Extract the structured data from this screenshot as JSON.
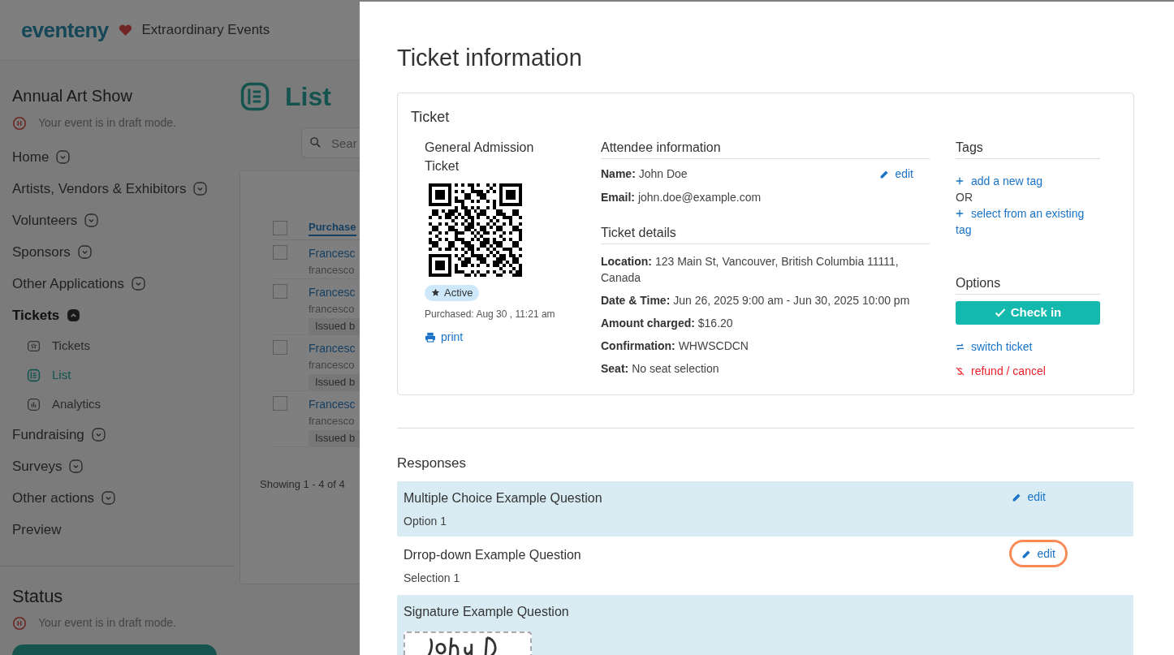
{
  "header": {
    "logo": "eventeny",
    "org": "Extraordinary Events"
  },
  "sidebar": {
    "event_title": "Annual Art Show",
    "draft_notice": "Your event is in draft mode.",
    "items": [
      {
        "label": "Home",
        "kind": "group",
        "expanded": false
      },
      {
        "label": "Artists, Vendors & Exhibitors",
        "kind": "group",
        "expanded": false
      },
      {
        "label": "Volunteers",
        "kind": "group",
        "expanded": false
      },
      {
        "label": "Sponsors",
        "kind": "group",
        "expanded": false
      },
      {
        "label": "Other Applications",
        "kind": "group",
        "expanded": false
      },
      {
        "label": "Tickets",
        "kind": "group",
        "expanded": true,
        "children": [
          {
            "label": "Tickets",
            "kind": "ticket",
            "selected": false
          },
          {
            "label": "List",
            "kind": "list",
            "selected": true
          },
          {
            "label": "Analytics",
            "kind": "chart",
            "selected": false
          }
        ]
      },
      {
        "label": "Fundraising",
        "kind": "group",
        "expanded": false
      },
      {
        "label": "Surveys",
        "kind": "group",
        "expanded": false
      },
      {
        "label": "Other actions",
        "kind": "group",
        "expanded": false
      },
      {
        "label": "Preview",
        "kind": "link",
        "expanded": false
      }
    ],
    "status": {
      "title": "Status",
      "notice": "Your event is in draft mode."
    }
  },
  "main": {
    "title": "List",
    "search": {
      "placeholder": "Sear"
    },
    "table": {
      "columns": [
        "Purchase"
      ],
      "select_all_checked": false,
      "rows": [
        {
          "name": "Francesc",
          "email": "francesco",
          "checked": false
        },
        {
          "name": "Francesc",
          "email": "francesco",
          "badge": "Issued b",
          "checked": false
        },
        {
          "name": "Francesc",
          "email": "francesco",
          "badge": "Issued b",
          "checked": false
        },
        {
          "name": "Francesc",
          "email": "francesco",
          "badge": "Issued b",
          "checked": false
        }
      ],
      "footer": "Showing 1 - 4 of 4"
    }
  },
  "modal": {
    "title": "Ticket information",
    "ticket": {
      "heading": "Ticket",
      "name": "General Admission Ticket",
      "status": "Active",
      "purchased": "Purchased: Aug 30 , 11:21 am",
      "print": "print",
      "attendee": {
        "heading": "Attendee information",
        "edit": "edit",
        "fields": [
          {
            "label": "Name:",
            "value": "John Doe"
          },
          {
            "label": "Email:",
            "value": "john.doe@example.com"
          }
        ]
      },
      "details": {
        "heading": "Ticket details",
        "fields": [
          {
            "label": "Location:",
            "value": "123 Main St, Vancouver, British Columbia 11111, Canada"
          },
          {
            "label": "Date & Time:",
            "value": "Jun 26, 2025 9:00 am - Jun 30, 2025 10:00 pm"
          },
          {
            "label": "Amount charged:",
            "value": "$16.20"
          },
          {
            "label": "Confirmation:",
            "value": "WHWSCDCN"
          },
          {
            "label": "Seat:",
            "value": "No seat selection"
          }
        ]
      },
      "tags": {
        "heading": "Tags",
        "add": "add a new tag",
        "or": "OR",
        "select": "select from an existing tag"
      },
      "options": {
        "heading": "Options",
        "check_in": "Check in",
        "switch": "switch ticket",
        "refund": "refund / cancel"
      }
    },
    "responses": {
      "heading": "Responses",
      "items": [
        {
          "question": "Multiple Choice Example Question",
          "answer": "Option 1",
          "kind": "text",
          "shaded": true,
          "edit": "edit",
          "focused": false
        },
        {
          "question": "Drrop-down Example Question",
          "answer": "Selection 1",
          "kind": "text",
          "shaded": false,
          "edit": "edit",
          "focused": true
        },
        {
          "question": "Signature Example Question",
          "kind": "signature",
          "shaded": true
        }
      ]
    }
  }
}
